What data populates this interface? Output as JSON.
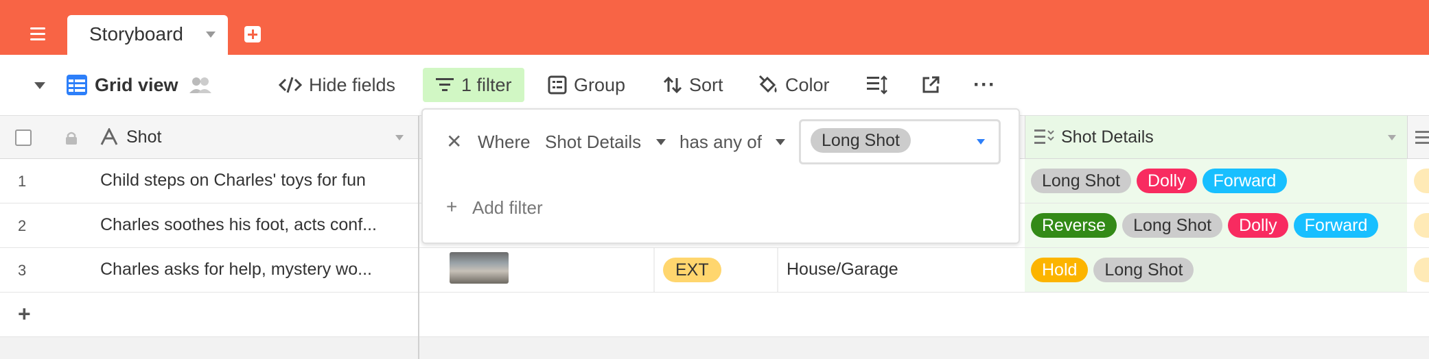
{
  "app": {
    "tab_active": "Storyboard"
  },
  "toolbar": {
    "view_name": "Grid view",
    "hide_fields": "Hide fields",
    "filter": "1 filter",
    "group": "Group",
    "sort": "Sort",
    "color": "Color",
    "more": "···"
  },
  "grid": {
    "columns": {
      "primary": "Shot",
      "shot_details": "Shot Details"
    },
    "rows": [
      {
        "num": "1",
        "shot": "Child steps on Charles' toys for fun",
        "location": "",
        "type": ""
      },
      {
        "num": "2",
        "shot": "Charles soothes his foot, acts conf...",
        "location": "",
        "type": ""
      },
      {
        "num": "3",
        "shot": "Charles asks for help, mystery wo...",
        "type": "EXT",
        "location": "House/Garage"
      }
    ],
    "shot_details": [
      [
        "Long Shot",
        "Dolly",
        "Forward"
      ],
      [
        "Reverse",
        "Long Shot",
        "Dolly",
        "Forward"
      ],
      [
        "Hold",
        "Long Shot"
      ]
    ],
    "add_row": "+"
  },
  "filter_popup": {
    "where": "Where",
    "field": "Shot Details",
    "operator": "has any of",
    "value": "Long Shot",
    "add_filter": "Add filter"
  },
  "colors": {
    "brand": "#f86445",
    "Long Shot": "#cccccc",
    "Dolly": "#f82b60",
    "Forward": "#18bfff",
    "Reverse": "#20c933",
    "Hold": "#fcb400",
    "EXT": "#ffd66e"
  }
}
